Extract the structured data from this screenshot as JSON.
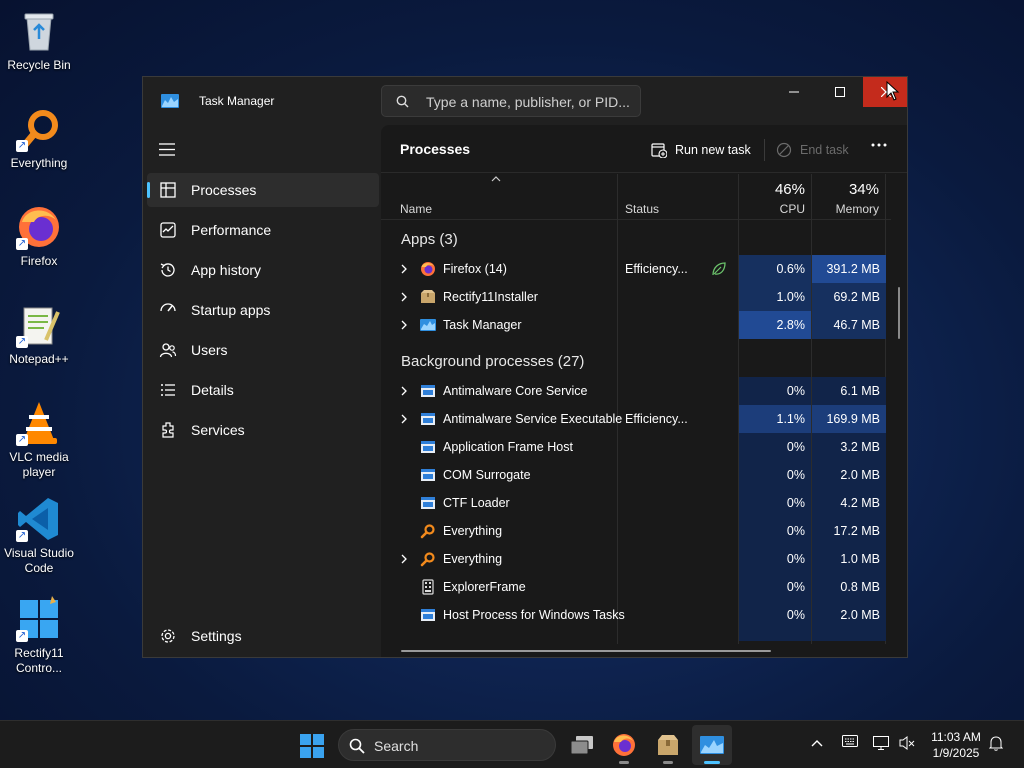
{
  "desktop": {
    "icons": [
      {
        "label": "Recycle Bin",
        "icon": "recycle-bin-icon"
      },
      {
        "label": "Everything",
        "icon": "everything-icon"
      },
      {
        "label": "Firefox",
        "icon": "firefox-icon"
      },
      {
        "label": "Notepad++",
        "icon": "notepadpp-icon"
      },
      {
        "label": "VLC media player",
        "icon": "vlc-icon"
      },
      {
        "label": "Visual Studio Code",
        "icon": "vscode-icon"
      },
      {
        "label": "Rectify11 Contro...",
        "icon": "rectify11-control-icon"
      }
    ]
  },
  "window": {
    "title": "Task Manager",
    "search_placeholder": "Type a name, publisher, or PID..."
  },
  "sidebar": {
    "items": [
      {
        "label": "Processes",
        "icon": "processes-icon",
        "active": true
      },
      {
        "label": "Performance",
        "icon": "performance-icon"
      },
      {
        "label": "App history",
        "icon": "app-history-icon"
      },
      {
        "label": "Startup apps",
        "icon": "startup-apps-icon"
      },
      {
        "label": "Users",
        "icon": "users-icon"
      },
      {
        "label": "Details",
        "icon": "details-icon"
      },
      {
        "label": "Services",
        "icon": "services-icon"
      }
    ],
    "settings_label": "Settings"
  },
  "page": {
    "title": "Processes",
    "run_new_task": "Run new task",
    "end_task": "End task"
  },
  "columns": {
    "name": "Name",
    "status": "Status",
    "cpu_pct": "46%",
    "cpu": "CPU",
    "mem_pct": "34%",
    "memory": "Memory"
  },
  "groups": {
    "apps": "Apps (3)",
    "background": "Background processes (27)"
  },
  "apps": [
    {
      "name": "Firefox (14)",
      "status": "Efficiency...",
      "cpu": "0.6%",
      "memory": "391.2 MB",
      "expandable": true,
      "icon": "firefox-icon",
      "leaf": true
    },
    {
      "name": "Rectify11Installer",
      "status": "",
      "cpu": "1.0%",
      "memory": "69.2 MB",
      "expandable": true,
      "icon": "installer-box-icon"
    },
    {
      "name": "Task Manager",
      "status": "",
      "cpu": "2.8%",
      "memory": "46.7 MB",
      "expandable": true,
      "icon": "task-manager-icon"
    }
  ],
  "background": [
    {
      "name": "Antimalware Core Service",
      "status": "",
      "cpu": "0%",
      "memory": "6.1 MB",
      "expandable": true,
      "icon": "window-app-icon"
    },
    {
      "name": "Antimalware Service Executable",
      "status": "Efficiency...",
      "cpu": "1.1%",
      "memory": "169.9 MB",
      "expandable": true,
      "icon": "window-app-icon"
    },
    {
      "name": "Application Frame Host",
      "status": "",
      "cpu": "0%",
      "memory": "3.2 MB",
      "expandable": false,
      "icon": "window-app-icon"
    },
    {
      "name": "COM Surrogate",
      "status": "",
      "cpu": "0%",
      "memory": "2.0 MB",
      "expandable": false,
      "icon": "window-app-icon"
    },
    {
      "name": "CTF Loader",
      "status": "",
      "cpu": "0%",
      "memory": "4.2 MB",
      "expandable": false,
      "icon": "window-app-icon"
    },
    {
      "name": "Everything",
      "status": "",
      "cpu": "0%",
      "memory": "17.2 MB",
      "expandable": false,
      "icon": "everything-icon"
    },
    {
      "name": "Everything",
      "status": "",
      "cpu": "0%",
      "memory": "1.0 MB",
      "expandable": true,
      "icon": "everything-icon"
    },
    {
      "name": "ExplorerFrame",
      "status": "",
      "cpu": "0%",
      "memory": "0.8 MB",
      "expandable": false,
      "icon": "explorer-frame-icon"
    },
    {
      "name": "Host Process for Windows Tasks",
      "status": "",
      "cpu": "0%",
      "memory": "2.0 MB",
      "expandable": false,
      "icon": "window-app-icon"
    }
  ],
  "taskbar": {
    "search_label": "Search",
    "time": "11:03 AM",
    "date": "1/9/2025"
  },
  "colors": {
    "accent": "#4cc2ff",
    "close": "#c42b1c",
    "heat_high": "#214a94",
    "heat_low": "#112449"
  }
}
